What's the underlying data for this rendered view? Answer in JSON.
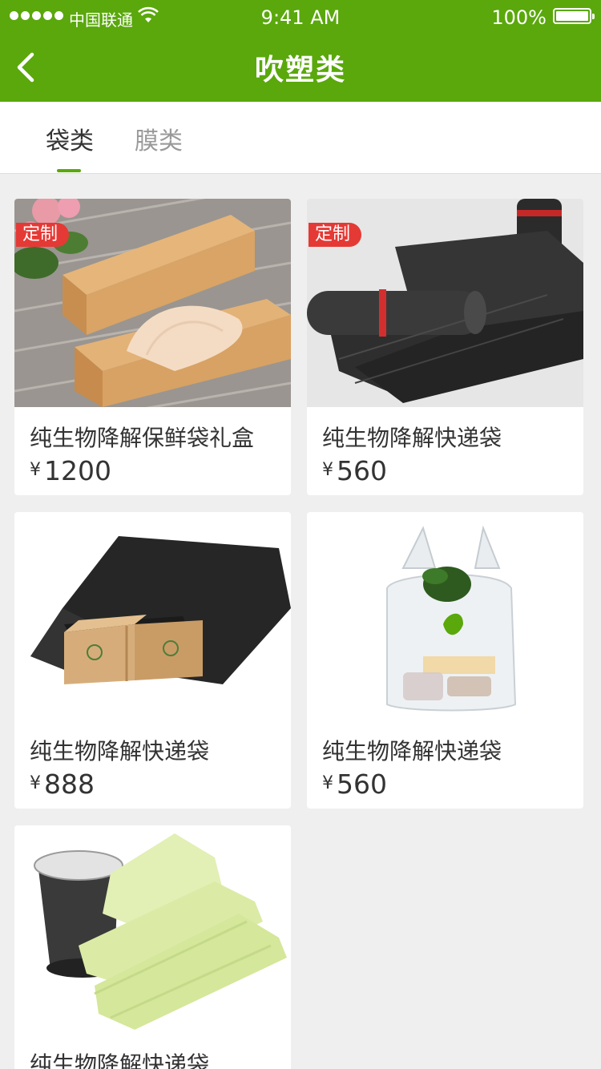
{
  "status_bar": {
    "carrier": "中国联通",
    "time": "9:41 AM",
    "battery": "100%"
  },
  "header": {
    "title": "吹塑类"
  },
  "tabs": [
    {
      "label": "袋类",
      "active": true
    },
    {
      "label": "膜类",
      "active": false
    }
  ],
  "products": [
    {
      "title": "纯生物降解保鲜袋礼盒",
      "currency": "¥",
      "price": "1200",
      "tag": "定制",
      "image_icon": "kraft-box-image"
    },
    {
      "title": "纯生物降解快递袋",
      "currency": "¥",
      "price": "560",
      "tag": "定制",
      "image_icon": "black-roll-bags-image"
    },
    {
      "title": "纯生物降解快递袋",
      "currency": "¥",
      "price": "888",
      "image_icon": "black-mailer-bag-image"
    },
    {
      "title": "纯生物降解快递袋",
      "currency": "¥",
      "price": "560",
      "image_icon": "shopping-bag-image"
    },
    {
      "title": "纯生物降解快递袋",
      "currency": "¥",
      "price": "",
      "image_icon": "yellow-trash-bags-image"
    }
  ],
  "colors": {
    "brand_green": "#5aa80c",
    "tag_red": "#e53935",
    "page_bg": "#efefef"
  }
}
